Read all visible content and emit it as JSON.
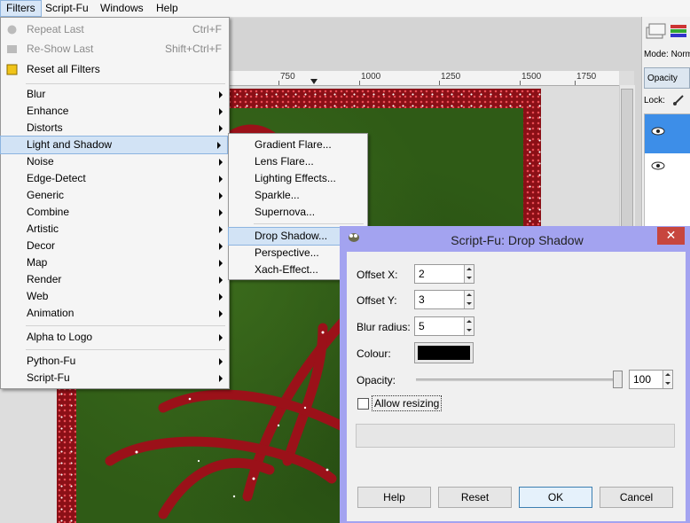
{
  "menubar": {
    "items": [
      "Filters",
      "Script-Fu",
      "Windows",
      "Help"
    ]
  },
  "ruler": {
    "labels": [
      "750",
      "1000",
      "1250",
      "1500",
      "1750"
    ]
  },
  "dock": {
    "mode_label": "Mode: Norm",
    "opacity_label": "Opacity",
    "lock_label": "Lock:"
  },
  "filters_menu": {
    "repeat_last": "Repeat Last",
    "repeat_last_shortcut": "Ctrl+F",
    "reshow_last": "Re-Show Last",
    "reshow_last_shortcut": "Shift+Ctrl+F",
    "reset_all": "Reset all Filters",
    "items": [
      "Blur",
      "Enhance",
      "Distorts",
      "Light and Shadow",
      "Noise",
      "Edge-Detect",
      "Generic",
      "Combine",
      "Artistic",
      "Decor",
      "Map",
      "Render",
      "Web",
      "Animation"
    ],
    "alpha_to_logo": "Alpha to Logo",
    "python_fu": "Python-Fu",
    "script_fu": "Script-Fu"
  },
  "light_shadow_menu": {
    "items": [
      "Gradient Flare...",
      "Lens Flare...",
      "Lighting Effects...",
      "Sparkle...",
      "Supernova..."
    ],
    "items2": [
      "Drop Shadow...",
      "Perspective...",
      "Xach-Effect..."
    ]
  },
  "dialog": {
    "title": "Script-Fu: Drop Shadow",
    "close_glyph": "✕",
    "offset_x_label": "Offset X:",
    "offset_x_value": "2",
    "offset_y_label": "Offset Y:",
    "offset_y_value": "3",
    "blur_label": "Blur radius:",
    "blur_value": "5",
    "colour_label": "Colour:",
    "colour_value": "#000000",
    "opacity_label": "Opacity:",
    "opacity_value": "100",
    "opacity_level": 100,
    "allow_resizing_label": "Allow resizing",
    "allow_resizing_checked": false,
    "help_button": "Help",
    "reset_button": "Reset",
    "ok_button": "OK",
    "cancel_button": "Cancel"
  },
  "colors": {
    "menu_highlight": "#d2e3f5",
    "dialog_frame": "#a3a3f0",
    "close_button": "#c7463e",
    "layer_selected": "#3d8ee8",
    "image_red": "#8b0f16",
    "image_green": "#2f5b16"
  }
}
